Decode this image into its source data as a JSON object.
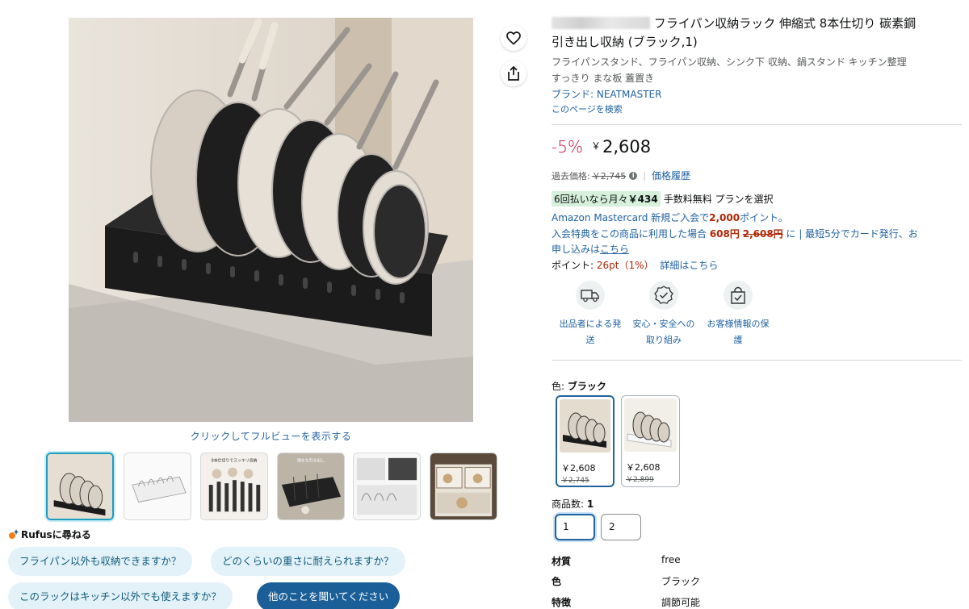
{
  "gallery": {
    "fullview_link": "クリックしてフルビューを表示する",
    "thumbnail_count": 6,
    "selected_thumbnail_index": 0,
    "thumb2_text": "8本仕切りでスッキリ収納",
    "thumb3_text": "頑丈な引き出し"
  },
  "rufus": {
    "title": "Rufusに尋ねる",
    "questions": [
      "フライパン以外も収納できますか？",
      "どのくらいの重さに耐えられますか？",
      "このラックはキッチン以外でも使えますか？"
    ],
    "ask_other": "他のことを聞いてください"
  },
  "actions": {
    "wishlist_icon": "heart-icon",
    "share_icon": "share-icon"
  },
  "product": {
    "title_line1": "フライパン収納ラック 伸縮式 8本仕切り 碳素鋼",
    "title_line2": "引き出し収納 (ブラック,1)",
    "subtitle_line1": "フライパンスタンド、フライパン収納、シンク下 収納、鍋スタンド キッチン整理",
    "subtitle_line2": "すっきり まな板 蓋置き",
    "brand": "ブランド: NEATMASTER",
    "search_page": "このページを検索"
  },
  "price": {
    "discount": "-5%",
    "currency": "￥",
    "value": "2,608",
    "past_label": "過去価格:",
    "past_value": "￥2,745",
    "history_link": "価格履歴"
  },
  "installment": {
    "prefix": "6回払いなら月々",
    "amount": "￥434",
    "rest": "手数料無料 プランを選択"
  },
  "card_offer": {
    "line1_a": "Amazon Mastercard 新規ご入会で",
    "line1_points": "2,000",
    "line1_b": "ポイント。",
    "line2_a": "入会特典をこの商品に利用した場合 ",
    "line2_price": "608円",
    "line2_old": "2,608円",
    "line2_b": " に | 最短5分でカード発行、お",
    "line3_a": "申し込みは",
    "line3_link": "こちら"
  },
  "points": {
    "label": "ポイント:",
    "value": "26pt（1%）",
    "details_link": "詳細はこちら"
  },
  "features": [
    {
      "icon": "delivery-truck-icon",
      "label_line1": "出品者による発",
      "label_line2": "送"
    },
    {
      "icon": "safety-badge-icon",
      "label_line1": "安心・安全への",
      "label_line2": "取り組み"
    },
    {
      "icon": "secure-checkout-icon",
      "label_line1": "お客様情報の保",
      "label_line2": "護"
    }
  ],
  "color": {
    "label": "色: ",
    "selected": "ブラック",
    "options": [
      {
        "price": "￥2,608",
        "old_price": "￥2,745",
        "variant": "black"
      },
      {
        "price": "￥2,608",
        "old_price": "￥2,899",
        "variant": "white"
      }
    ]
  },
  "quantity": {
    "label": "商品数: ",
    "selected": "1",
    "options": [
      "1",
      "2"
    ]
  },
  "specs": [
    {
      "key": "材質",
      "value": "free"
    },
    {
      "key": "色",
      "value": "ブラック"
    },
    {
      "key": "特徴",
      "value": "調節可能"
    }
  ],
  "colors": {
    "link": "#2162a1",
    "discount": "#cc0c39",
    "chip_bg": "#e3f2f8",
    "chip_primary": "#1b5f98",
    "installment_bg": "#d6f0dc"
  }
}
